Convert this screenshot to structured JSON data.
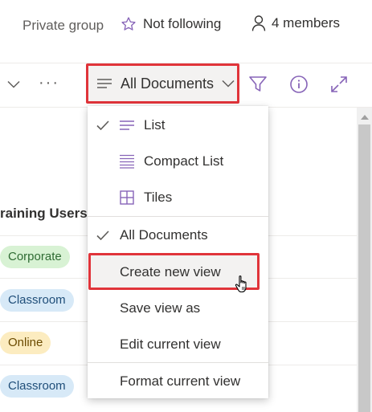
{
  "header": {
    "privacy": "Private group",
    "follow_label": "Not following",
    "members_label": "4 members"
  },
  "commandbar": {
    "more_label": "···",
    "view_button_label": "All Documents"
  },
  "list": {
    "column_header": "raining Users",
    "rows": [
      {
        "tag": "Corporate"
      },
      {
        "tag": "Classroom"
      },
      {
        "tag": "Online"
      },
      {
        "tag": "Classroom"
      }
    ]
  },
  "menu": {
    "layout_items": [
      {
        "label": "List",
        "checked": true,
        "icon": "list-lines-icon"
      },
      {
        "label": "Compact List",
        "checked": false,
        "icon": "compact-list-icon"
      },
      {
        "label": "Tiles",
        "checked": false,
        "icon": "tiles-icon"
      }
    ],
    "view_items": [
      {
        "label": "All Documents",
        "checked": true
      },
      {
        "label": "Create new view",
        "checked": false
      },
      {
        "label": "Save view as",
        "checked": false
      },
      {
        "label": "Edit current view",
        "checked": false
      }
    ],
    "format_item": {
      "label": "Format current view"
    }
  },
  "colors": {
    "accent": "#8764b8",
    "highlight_border": "#e0343a",
    "corporate_tag": "#d8f2d4",
    "classroom_tag": "#d7e9f7",
    "online_tag": "#fcecc0"
  }
}
